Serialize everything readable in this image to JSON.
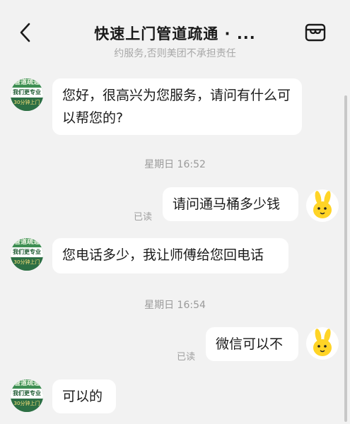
{
  "header": {
    "title": "快速上门管道疏通 · ...",
    "notice": "约服务,否则美团不承担责任",
    "back_icon": "chevron-left-icon",
    "shop_icon": "storefront-icon"
  },
  "shop_avatar": {
    "line1": "管道疏通",
    "line2": "我们更专业",
    "line3": "30分钟上门"
  },
  "messages": [
    {
      "sender": "shop",
      "text": "您好，很高兴为您服务，请问有什么可以帮您的?"
    },
    {
      "sender": "system",
      "text": "星期日 16:52"
    },
    {
      "sender": "user",
      "text": "请问通马桶多少钱",
      "status": "已读"
    },
    {
      "sender": "shop",
      "text": "您电话多少，我让师傅给您回电话"
    },
    {
      "sender": "system",
      "text": "星期日 16:54"
    },
    {
      "sender": "user",
      "text": "微信可以不",
      "status": "已读"
    },
    {
      "sender": "shop",
      "text": "可以的"
    }
  ],
  "colors": {
    "background": "#f2f2f2",
    "bubble": "#ffffff",
    "shop_avatar_green": "#2f7a4a",
    "user_avatar_yellow": "#ffd426"
  }
}
